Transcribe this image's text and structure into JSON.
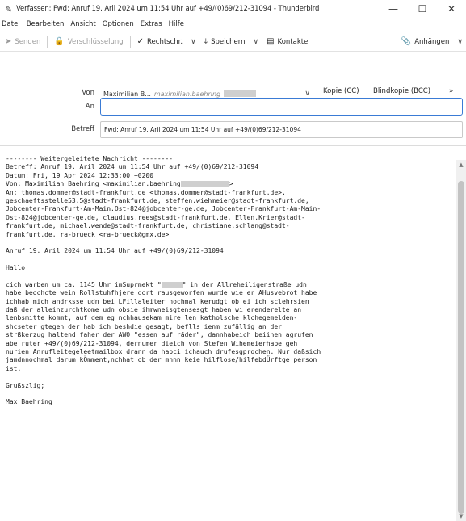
{
  "window": {
    "title": "Verfassen: Fwd: Anruf 19. Aril 2024 um 11:54 Uhr auf +49/(0)69/212-31094 - Thunderbird",
    "minimize": "—",
    "maximize": "☐",
    "close": "✕"
  },
  "menu": {
    "items": [
      "Datei",
      "Bearbeiten",
      "Ansicht",
      "Optionen",
      "Extras",
      "Hilfe"
    ]
  },
  "toolbar": {
    "send": "Senden",
    "encrypt": "Verschlüsselung",
    "spell": "Rechtschr.",
    "save": "Speichern",
    "contacts": "Kontakte",
    "attach": "Anhängen"
  },
  "header": {
    "from_label": "Von",
    "from_name": "Maximilian B...",
    "from_addr": "maximilian.baehring",
    "cc_button": "Kopie (CC)",
    "bcc_button": "Blindkopie (BCC)",
    "more": "»",
    "to_label": "An",
    "subject_label": "Betreff",
    "subject_value": "Fwd: Anruf 19. Aril 2024 um 11:54 Uhr auf +49/(0)69/212-31094"
  },
  "body": {
    "lines": [
      "-------- Weitergeleitete Nachricht --------",
      "Betreff: Anruf 19. Aril 2024 um 11:54 Uhr auf +49/(0)69/212-31094",
      "Datum: Fri, 19 Apr 2024 12:33:00 +0200",
      "Von: Maximilian Baehring <maximilian.baehring",
      "An: thomas.dommer@stadt-frankfurt.de <thomas.dommer@stadt-frankfurt.de>,",
      "geschaeftsstelle53.5@stadt-frankfurt.de, steffen.wiehmeier@stadt-frankfurt.de,",
      "Jobcenter-Frankfurt-Am-Main.Ost-824@jobcenter-ge.de, Jobcenter-Frankfurt-Am-Main-",
      "Ost-824@jobcenter-ge.de, claudius.rees@stadt-frankfurt.de, Ellen.Krier@stadt-",
      "frankfurt.de, michael.wende@stadt-frankfurt.de, christiane.schlang@stadt-",
      "frankfurt.de, ra-brueck <ra-brueck@gmx.de>",
      "",
      "Anruf 19. Aril 2024 um 11:54 Uhr auf +49/(0)69/212-31094",
      "",
      "Hallo",
      "",
      "cich warben um ca. 1145 Uhr imSuprmekt \"",
      "habe beochcte wein Rollstuhfhjere dort rausgeworfen wurde wie er AHusvebrot habe",
      "ichhab mich andrksse udn bei LFillaleiter nochmal kerudgt ob ei ich sclehrsien",
      "daß der alleinzurchtkome udn obsie ihmwneisgtensesgt haben wi erenderelte an",
      "lenbsmitte kommt, auf dem eg nchhausekam mire len katholsche klchegemelden-",
      "shcseter gtegen der hab ich beshdie gesagt, beflls ienm zufällig an der",
      "strßkerzug haltend faher der AWO \"essen auf räder\", dannhabeich beiihen agrufen",
      "abe ruter +49/(0)69/212-31094, dernumer dieich von Stefen Wihemeierhabe geh",
      "nurien Anrufleitegeleetmailbox drann da habci ichauch drufesgprochen. Nur daßsich",
      "jamdnnochmal darum kÖmment,nchhat ob der mnnn keie hilflose/hilfebdÜrftge person",
      "ist.",
      "",
      "Grußszlig;",
      "",
      "Max Baehring"
    ],
    "from_tail": ">",
    "shop_tail": "\" in der Allreheiligenstraße udn"
  }
}
